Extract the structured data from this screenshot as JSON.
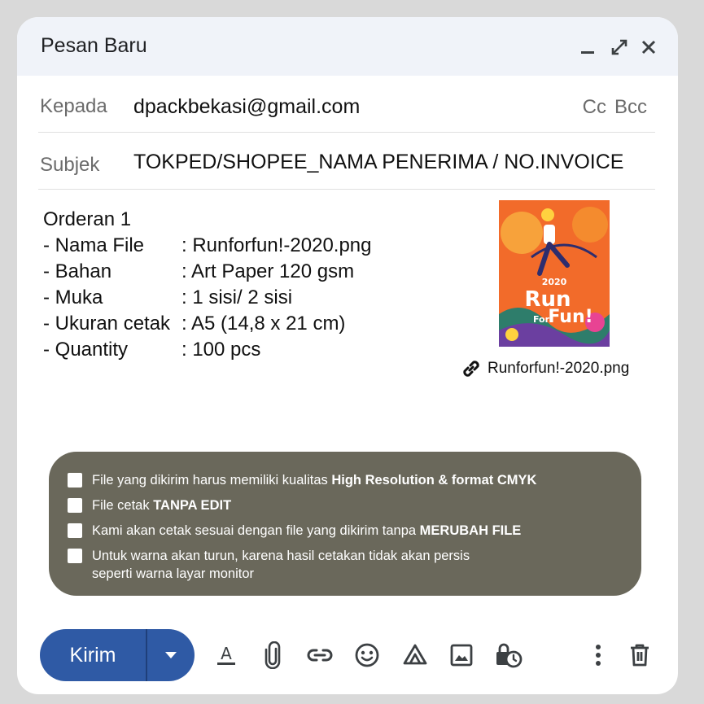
{
  "window": {
    "title": "Pesan Baru",
    "controls": [
      "minimize-icon",
      "expand-icon",
      "close-icon"
    ]
  },
  "to": {
    "label": "Kepada",
    "value": "dpackbekasi@gmail.com",
    "cc": "Cc",
    "bcc": "Bcc"
  },
  "subject": {
    "label": "Subjek",
    "value": "TOKPED/SHOPEE_NAMA PENERIMA / NO.INVOICE"
  },
  "body": {
    "heading": "Orderan 1",
    "fields": [
      {
        "key": "- Nama File",
        "value": ": Runforfun!-2020.png"
      },
      {
        "key": "- Bahan",
        "value": ": Art Paper 120 gsm"
      },
      {
        "key": "- Muka",
        "value": ": 1 sisi/ 2 sisi"
      },
      {
        "key": "- Ukuran cetak",
        "value": ": A5 (14,8 x 21 cm)"
      },
      {
        "key": "- Quantity",
        "value": ": 100 pcs"
      }
    ]
  },
  "attachment": {
    "filename": "Runforfun!-2020.png",
    "poster": {
      "year": "2020",
      "line1": "Run",
      "line2": "For",
      "line3": "Fun!"
    }
  },
  "checklist": [
    {
      "text": "File yang dikirim harus memiliki kualitas ",
      "bold": "High Resolution & format CMYK",
      "text2": ""
    },
    {
      "text": "File cetak ",
      "bold": "TANPA EDIT",
      "text2": ""
    },
    {
      "text": "Kami akan cetak sesuai dengan file yang dikirim tanpa ",
      "bold": "MERUBAH FILE",
      "text2": ""
    },
    {
      "text": "Untuk warna akan turun, karena hasil cetakan tidak akan persis",
      "bold": "",
      "text2": "seperti warna layar monitor"
    }
  ],
  "toolbar": {
    "send_label": "Kirim",
    "tools": [
      "format-text-icon",
      "attach-icon",
      "link-icon",
      "emoji-icon",
      "drive-icon",
      "photo-icon",
      "confidential-icon",
      "more-options-icon",
      "trash-icon"
    ]
  },
  "colors": {
    "titlebar": "#f0f3f9",
    "send_button": "#2f5aa5",
    "notice_bg": "#6a685b",
    "poster_bg": "#f26b2a"
  }
}
